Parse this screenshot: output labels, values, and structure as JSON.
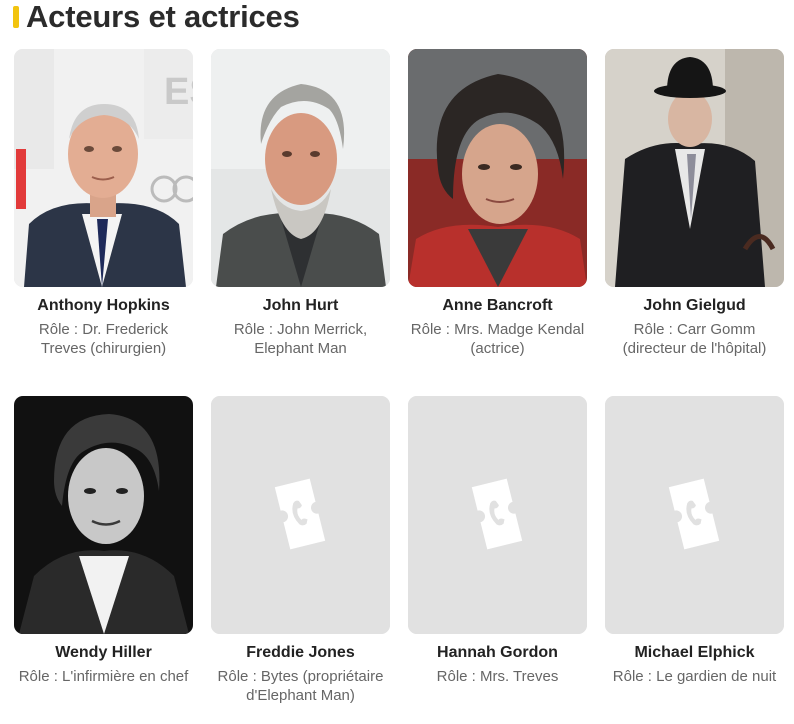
{
  "section": {
    "title": "Acteurs et actrices",
    "accent_color": "#f2c40f"
  },
  "cast": [
    {
      "name": "Anthony Hopkins",
      "role": "Rôle : Dr. Frederick Treves (chirurgien)",
      "has_photo": true
    },
    {
      "name": "John Hurt",
      "role": "Rôle : John Merrick, Elephant Man",
      "has_photo": true
    },
    {
      "name": "Anne Bancroft",
      "role": "Rôle : Mrs. Madge Kendal (actrice)",
      "has_photo": true
    },
    {
      "name": "John Gielgud",
      "role": "Rôle : Carr Gomm (directeur de l'hôpital)",
      "has_photo": true
    },
    {
      "name": "Wendy Hiller",
      "role": "Rôle : L'infirmière en chef",
      "has_photo": true
    },
    {
      "name": "Freddie Jones",
      "role": "Rôle : Bytes (propriétaire d'Elephant Man)",
      "has_photo": false,
      "icon": "ticket-icon"
    },
    {
      "name": "Hannah Gordon",
      "role": "Rôle : Mrs. Treves",
      "has_photo": false,
      "icon": "ticket-icon"
    },
    {
      "name": "Michael Elphick",
      "role": "Rôle : Le gardien de nuit",
      "has_photo": false,
      "icon": "ticket-icon"
    }
  ]
}
